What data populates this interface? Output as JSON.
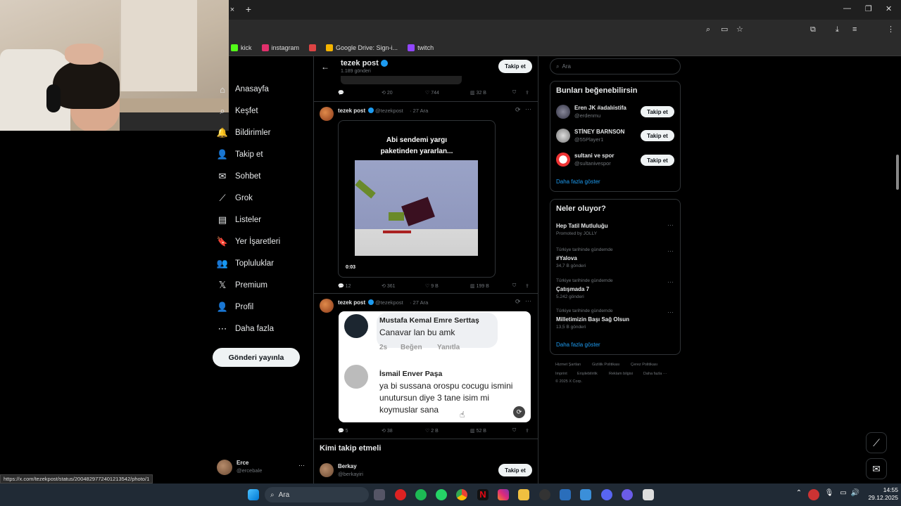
{
  "browser": {
    "new_tab_symbol": "+",
    "close_tab_symbol": "×",
    "bookmarks": [
      {
        "label": "kick",
        "color": "#53fc18"
      },
      {
        "label": "instagram",
        "color": "#e1306c"
      },
      {
        "label": "",
        "color": "#d44"
      },
      {
        "label": "Google Drive: Sign-i...",
        "color": "#f4b400"
      },
      {
        "label": "twitch",
        "color": "#9146ff"
      }
    ],
    "status_url": "https://x.com/tezekpost/status/2004829772401213542/photo/1"
  },
  "nav": {
    "items": [
      {
        "label": "Anasayfa",
        "icon": "home-icon",
        "glyph": "⌂"
      },
      {
        "label": "Keşfet",
        "icon": "explore-icon",
        "glyph": "⌕"
      },
      {
        "label": "Bildirimler",
        "icon": "bell-icon",
        "glyph": "🔔"
      },
      {
        "label": "Takip et",
        "icon": "follow-icon",
        "glyph": "👤"
      },
      {
        "label": "Sohbet",
        "icon": "mail-icon",
        "glyph": "✉"
      },
      {
        "label": "Grok",
        "icon": "grok-icon",
        "glyph": "⟋"
      },
      {
        "label": "Listeler",
        "icon": "list-icon",
        "glyph": "▤"
      },
      {
        "label": "Yer İşaretleri",
        "icon": "bookmark-icon",
        "glyph": "🔖"
      },
      {
        "label": "Topluluklar",
        "icon": "communities-icon",
        "glyph": "👥"
      },
      {
        "label": "Premium",
        "icon": "x-logo-icon",
        "glyph": "𝕏"
      },
      {
        "label": "Profil",
        "icon": "profile-icon",
        "glyph": "👤"
      },
      {
        "label": "Daha fazla",
        "icon": "more-icon",
        "glyph": "⋯"
      }
    ],
    "post_button": "Gönderi yayınla",
    "profile": {
      "name": "Erce",
      "handle": "@ercebale",
      "menu": "···"
    }
  },
  "header": {
    "back_glyph": "←",
    "title": "tezek post",
    "subtitle": "1.189 gönderi",
    "follow_label": "Takip et"
  },
  "top_actions": {
    "replies": "",
    "reposts": "20",
    "likes": "744",
    "views": "32 B"
  },
  "posts": [
    {
      "author": "tezek post",
      "handle": "@tezekpost",
      "date": "· 27 Ara",
      "video_caption_line1": "Abi sendemi yargı",
      "video_caption_line2": "paketinden yararlan...",
      "video_time": "0:03",
      "replies": "12",
      "reposts": "361",
      "likes": "9 B",
      "views": "199 B"
    },
    {
      "author": "tezek post",
      "handle": "@tezekpost",
      "date": "· 27 Ara",
      "comment1_name": "Mustafa Kemal Emre Serttaş",
      "comment1_text": "Canavar lan bu amk",
      "comment1_meta_time": "2s",
      "comment1_meta_like": "Beğen",
      "comment1_meta_reply": "Yanıtla",
      "comment2_name": "İsmail Enver Paşa",
      "comment2_line1": "ya bi sussana orospu cocugu ismini",
      "comment2_line2": "unutursun diye 3 tane isim mi",
      "comment2_line3": "koymuslar sana",
      "replies": "5",
      "reposts": "38",
      "likes": "2 B",
      "views": "52 B"
    }
  ],
  "who_to_follow": {
    "title": "Kimi takip etmeli",
    "user_name": "Berkay",
    "user_handle": "@berkayiri",
    "follow_label": "Takip et"
  },
  "right": {
    "search_placeholder": "Ara",
    "suggestions_title": "Bunları beğenebilirsin",
    "suggestions": [
      {
        "name": "Eren JK #adalıistifa",
        "handle": "@erdenmu",
        "button": "Takip et"
      },
      {
        "name": "STİNEY BARNSON",
        "handle": "@55Player1",
        "button": "Takip et"
      },
      {
        "name": "sultani ve spor",
        "handle": "@sultanivespor",
        "button": "Takip et"
      }
    ],
    "suggestions_more": "Daha fazla göster",
    "trends_title": "Neler oluyor?",
    "trends": [
      {
        "meta": "",
        "name": "Hep Tatil Mutluluğu",
        "count": "Promoted by JOLLY"
      },
      {
        "meta": "Türkiye tarihinde gündemde",
        "name": "#Yalova",
        "count": "34,7 B gönderi"
      },
      {
        "meta": "Türkiye tarihinde gündemde",
        "name": "Çatışmada 7",
        "count": "5.242 gönderi"
      },
      {
        "meta": "Türkiye tarihinde gündemde",
        "name": "Milletimizin Başı Sağ Olsun",
        "count": "13,5 B gönderi"
      }
    ],
    "trends_more": "Daha fazla göster",
    "footer": [
      "Hizmet Şartları",
      "Gizlilik Politikası",
      "Çerez Politikası",
      "Imprint",
      "Erişilebilirlik",
      "Reklam bilgisi",
      "Daha fazla ···",
      "© 2025 X Corp."
    ]
  },
  "taskbar": {
    "search_label": "Ara",
    "time": "14:55",
    "date": "29.12.2025"
  }
}
